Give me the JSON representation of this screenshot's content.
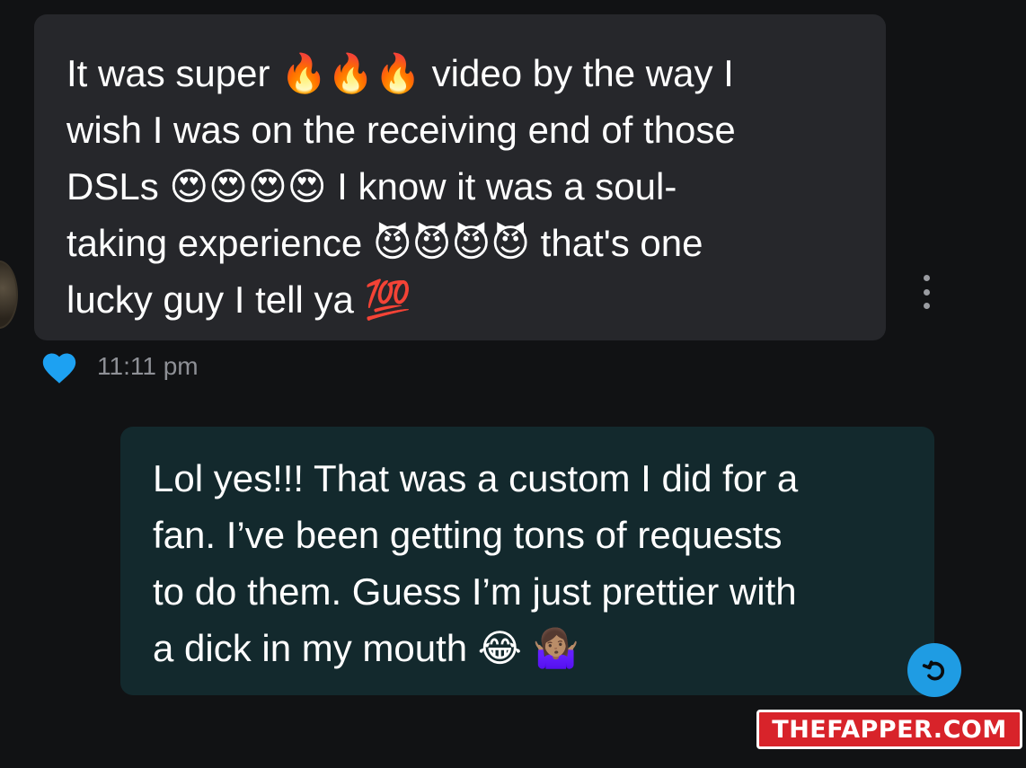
{
  "incoming_message": {
    "lines": [
      "It was super 🔥🔥🔥 video by the way I",
      "wish I was on the receiving end of those",
      "DSLs 😍😍😍😍 I know it was a soul-",
      "taking experience 😈😈😈😈 that's one",
      "lucky guy I tell ya 💯"
    ],
    "time": "11:11 pm",
    "reaction": "heart-icon",
    "options": "more-icon"
  },
  "outgoing_message": {
    "lines": [
      "Lol yes!!! That was a custom I did for a",
      "fan. I’ve been getting tons of requests",
      "to do them. Guess I’m just prettier with",
      "a dick in my mouth 😂 🤷🏽‍♀️"
    ],
    "action": "reply-icon"
  },
  "watermark": {
    "text": "THEFAPPER.COM"
  },
  "colors": {
    "background": "#111214",
    "incoming_bubble": "#26272b",
    "outgoing_bubble": "#13292d",
    "heart": "#1da1f2",
    "reply_button": "#1f9ce3",
    "watermark_red": "#d8232a"
  }
}
